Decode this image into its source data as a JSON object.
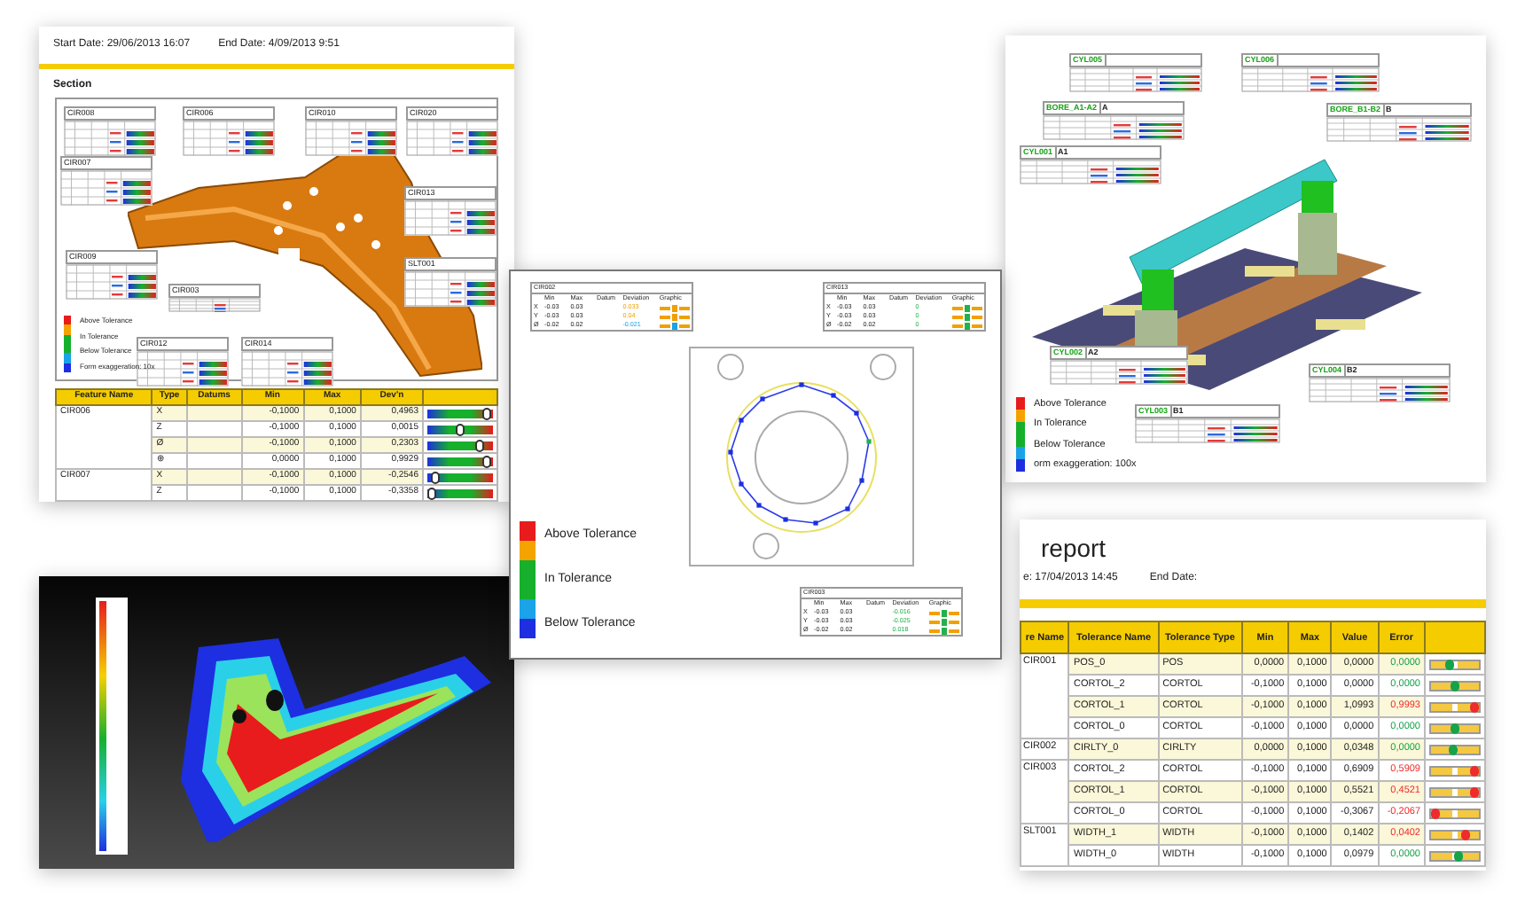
{
  "section_report": {
    "start_date": "Start Date: 29/06/2013 16:07",
    "end_date": "End Date: 4/09/2013 9:51",
    "section_title": "Section",
    "callouts": [
      "CIR008",
      "CIR006",
      "CIR010",
      "CIR020",
      "CIR007",
      "CIR013",
      "CIR009",
      "CIR003",
      "SLT001",
      "CIR012",
      "CIR014"
    ],
    "legend": [
      "Above Tolerance",
      "In Tolerance",
      "Below Tolerance",
      "Form exaggeration: 10x"
    ],
    "table": {
      "columns": [
        "Feature Name",
        "Type",
        "Datums",
        "Min",
        "Max",
        "Dev'n"
      ],
      "features": [
        {
          "name": "CIR006",
          "rows": [
            {
              "type": "X",
              "min": "-0,1000",
              "max": "0,1000",
              "dev": "0,4963",
              "level": 0.97
            },
            {
              "type": "Z",
              "min": "-0,1000",
              "max": "0,1000",
              "dev": "0,0015",
              "level": 0.5
            },
            {
              "type": "Ø",
              "min": "-0,1000",
              "max": "0,1000",
              "dev": "0,2303",
              "level": 0.85
            },
            {
              "type": "⊕",
              "min": "0,0000",
              "max": "0,1000",
              "dev": "0,9929",
              "level": 0.97
            }
          ]
        },
        {
          "name": "CIR007",
          "rows": [
            {
              "type": "X",
              "min": "-0,1000",
              "max": "0,1000",
              "dev": "-0,2546",
              "level": 0.05
            },
            {
              "type": "Z",
              "min": "-0,1000",
              "max": "0,1000",
              "dev": "-0,3358",
              "level": 0.0
            }
          ]
        }
      ]
    }
  },
  "plate_report": {
    "callouts": [
      {
        "title": "CIR002",
        "columns": [
          "Min",
          "Max",
          "Datum",
          "Deviation",
          "Graphic"
        ],
        "rows": [
          {
            "axis": "X",
            "min": "-0.03",
            "max": "0.03",
            "dev": "0.033",
            "color": "#f0a000"
          },
          {
            "axis": "Y",
            "min": "-0.03",
            "max": "0.03",
            "dev": "0.04",
            "color": "#f0a000"
          },
          {
            "axis": "Ø",
            "min": "-0.02",
            "max": "0.02",
            "dev": "-0.021",
            "color": "#1aa3e8"
          }
        ]
      },
      {
        "title": "CIR013",
        "columns": [
          "Min",
          "Max",
          "Datum",
          "Deviation",
          "Graphic"
        ],
        "rows": [
          {
            "axis": "X",
            "min": "-0.03",
            "max": "0.03",
            "dev": "0",
            "color": "#22b14c"
          },
          {
            "axis": "Y",
            "min": "-0.03",
            "max": "0.03",
            "dev": "0",
            "color": "#22b14c"
          },
          {
            "axis": "Ø",
            "min": "-0.02",
            "max": "0.02",
            "dev": "0",
            "color": "#22b14c"
          }
        ]
      },
      {
        "title": "CIR003",
        "columns": [
          "Min",
          "Max",
          "Datum",
          "Deviation",
          "Graphic"
        ],
        "rows": [
          {
            "axis": "X",
            "min": "-0.03",
            "max": "0.03",
            "dev": "-0.016",
            "color": "#22b14c"
          },
          {
            "axis": "Y",
            "min": "-0.03",
            "max": "0.03",
            "dev": "-0.025",
            "color": "#22b14c"
          },
          {
            "axis": "Ø",
            "min": "-0.02",
            "max": "0.02",
            "dev": "0.018",
            "color": "#22b14c"
          }
        ]
      }
    ],
    "legend": [
      "Above Tolerance",
      "In Tolerance",
      "Below Tolerance"
    ]
  },
  "fixture_report": {
    "callouts": [
      {
        "title": "CYL005"
      },
      {
        "title": "CYL006"
      },
      {
        "title": "BORE_A1-A2",
        "tag": "A"
      },
      {
        "title": "BORE_B1-B2",
        "tag": "B"
      },
      {
        "title": "CYL001",
        "tag": "A1"
      },
      {
        "title": "CYL002",
        "tag": "A2"
      },
      {
        "title": "CYL003",
        "tag": "B1"
      },
      {
        "title": "CYL004",
        "tag": "B2"
      }
    ],
    "legend": [
      "Above Tolerance",
      "In Tolerance",
      "Below Tolerance",
      "orm exaggeration: 100x"
    ]
  },
  "tolerance_report": {
    "title": "report",
    "start_date": "e: 17/04/2013 14:45",
    "end_date": "End Date:",
    "columns": [
      "re Name",
      "Tolerance Name",
      "Tolerance Type",
      "Min",
      "Max",
      "Value",
      "Error"
    ],
    "features": [
      {
        "name": "CIR001",
        "rows": [
          {
            "tol": "POS_0",
            "type": "POS",
            "min": "0,0000",
            "max": "0,1000",
            "value": "0,0000",
            "error": "0,0000",
            "color": "#16a34a",
            "level": 0.38
          },
          {
            "tol": "CORTOL_2",
            "type": "CORTOL",
            "min": "-0,1000",
            "max": "0,1000",
            "value": "0,0000",
            "error": "0,0000",
            "color": "#16a34a",
            "level": 0.5
          },
          {
            "tol": "CORTOL_1",
            "type": "CORTOL",
            "min": "-0,1000",
            "max": "0,1000",
            "value": "1,0993",
            "error": "0,9993",
            "color": "#ef2b2b",
            "level": 1.0
          },
          {
            "tol": "CORTOL_0",
            "type": "CORTOL",
            "min": "-0,1000",
            "max": "0,1000",
            "value": "0,0000",
            "error": "0,0000",
            "color": "#16a34a",
            "level": 0.5
          }
        ]
      },
      {
        "name": "CIR002",
        "rows": [
          {
            "tol": "CIRLTY_0",
            "type": "CIRLTY",
            "min": "0,0000",
            "max": "0,1000",
            "value": "0,0348",
            "error": "0,0000",
            "color": "#16a34a",
            "level": 0.45
          }
        ]
      },
      {
        "name": "CIR003",
        "rows": [
          {
            "tol": "CORTOL_2",
            "type": "CORTOL",
            "min": "-0,1000",
            "max": "0,1000",
            "value": "0,6909",
            "error": "0,5909",
            "color": "#ef2b2b",
            "level": 1.0
          },
          {
            "tol": "CORTOL_1",
            "type": "CORTOL",
            "min": "-0,1000",
            "max": "0,1000",
            "value": "0,5521",
            "error": "0,4521",
            "color": "#ef2b2b",
            "level": 1.0
          },
          {
            "tol": "CORTOL_0",
            "type": "CORTOL",
            "min": "-0,1000",
            "max": "0,1000",
            "value": "-0,3067",
            "error": "-0,2067",
            "color": "#ef2b2b",
            "level": 0.0
          }
        ]
      },
      {
        "name": "SLT001",
        "rows": [
          {
            "tol": "WIDTH_1",
            "type": "WIDTH",
            "min": "-0,1000",
            "max": "0,1000",
            "value": "0,1402",
            "error": "0,0402",
            "color": "#ef2b2b",
            "level": 0.75
          },
          {
            "tol": "WIDTH_0",
            "type": "WIDTH",
            "min": "-0,1000",
            "max": "0,1000",
            "value": "0,0979",
            "error": "0,0000",
            "color": "#16a34a",
            "level": 0.6
          }
        ]
      }
    ]
  }
}
